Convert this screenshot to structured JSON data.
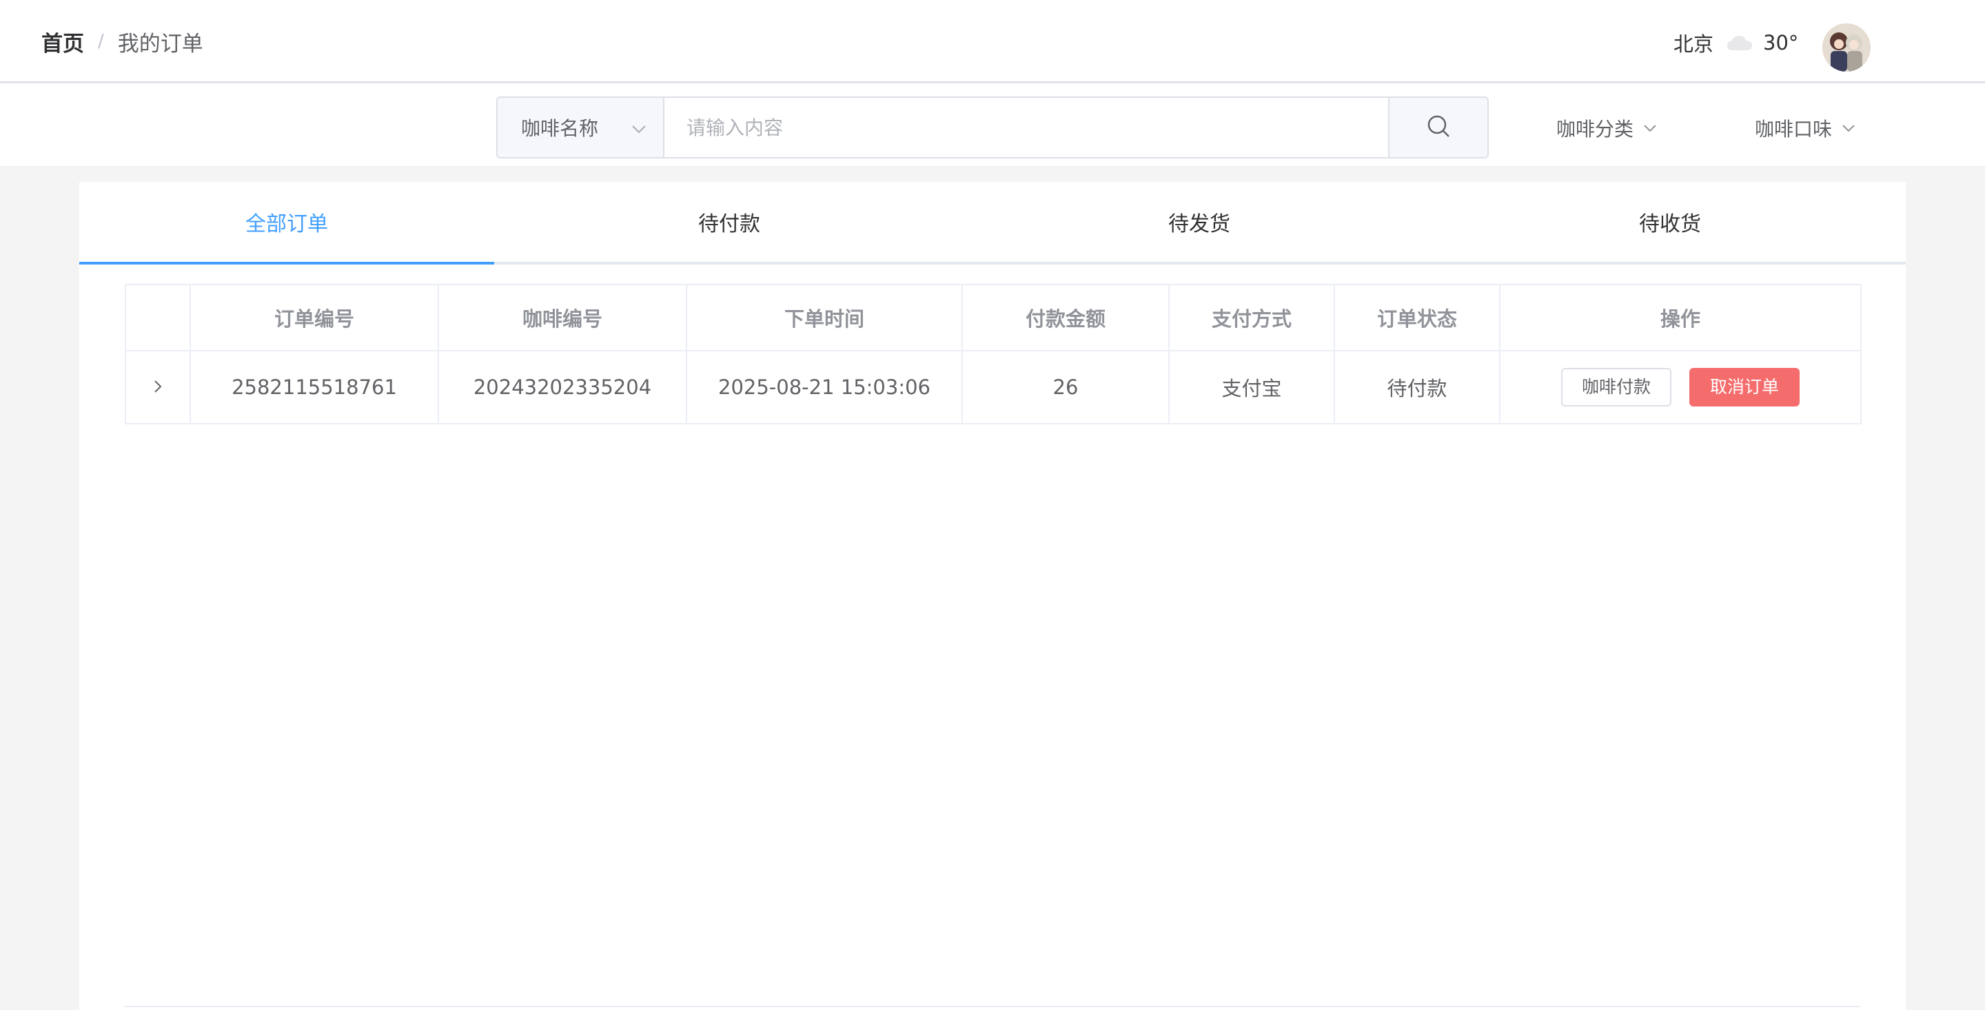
{
  "breadcrumb": {
    "home": "首页",
    "separator": "/",
    "current": "我的订单"
  },
  "weather": {
    "city": "北京",
    "icon": "cloud-icon",
    "temperature": "30°"
  },
  "search": {
    "select_label": "咖啡名称",
    "placeholder": "请输入内容",
    "search_icon": "search-icon"
  },
  "filters": {
    "category": "咖啡分类",
    "flavor": "咖啡口味"
  },
  "tabs": [
    {
      "label": "全部订单",
      "active": true
    },
    {
      "label": "待付款",
      "active": false
    },
    {
      "label": "待发货",
      "active": false
    },
    {
      "label": "待收货",
      "active": false
    }
  ],
  "table": {
    "headers": [
      "订单编号",
      "咖啡编号",
      "下单时间",
      "付款金额",
      "支付方式",
      "订单状态",
      "操作"
    ],
    "rows": [
      {
        "order_no": "2582115518761",
        "coffee_no": "20243202335204",
        "time": "2025-08-21 15:03:06",
        "amount": "26",
        "payment": "支付宝",
        "status": "待付款",
        "actions": {
          "pay": "咖啡付款",
          "cancel": "取消订单"
        }
      }
    ]
  },
  "colors": {
    "accent": "#409eff",
    "danger": "#f56c6c"
  }
}
